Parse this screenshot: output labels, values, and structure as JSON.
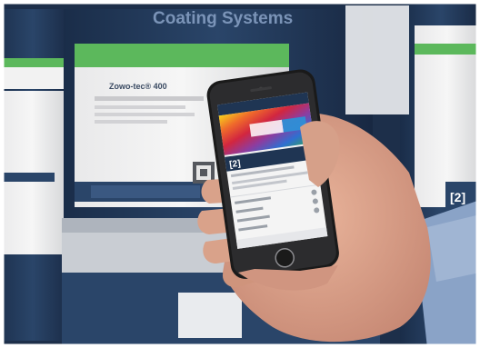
{
  "background": {
    "brand_line": "Coating Systems",
    "product_label": "Zowo-tec® 400",
    "can_number": "[2]"
  },
  "phone": {
    "app_logo": "[2]"
  },
  "colors": {
    "can_navy": "#1f3553",
    "label_green": "#5cb85c",
    "phone_body": "#1a1a1a",
    "skin": "#d9a28a",
    "shirt_blue": "#8aa3c7"
  }
}
